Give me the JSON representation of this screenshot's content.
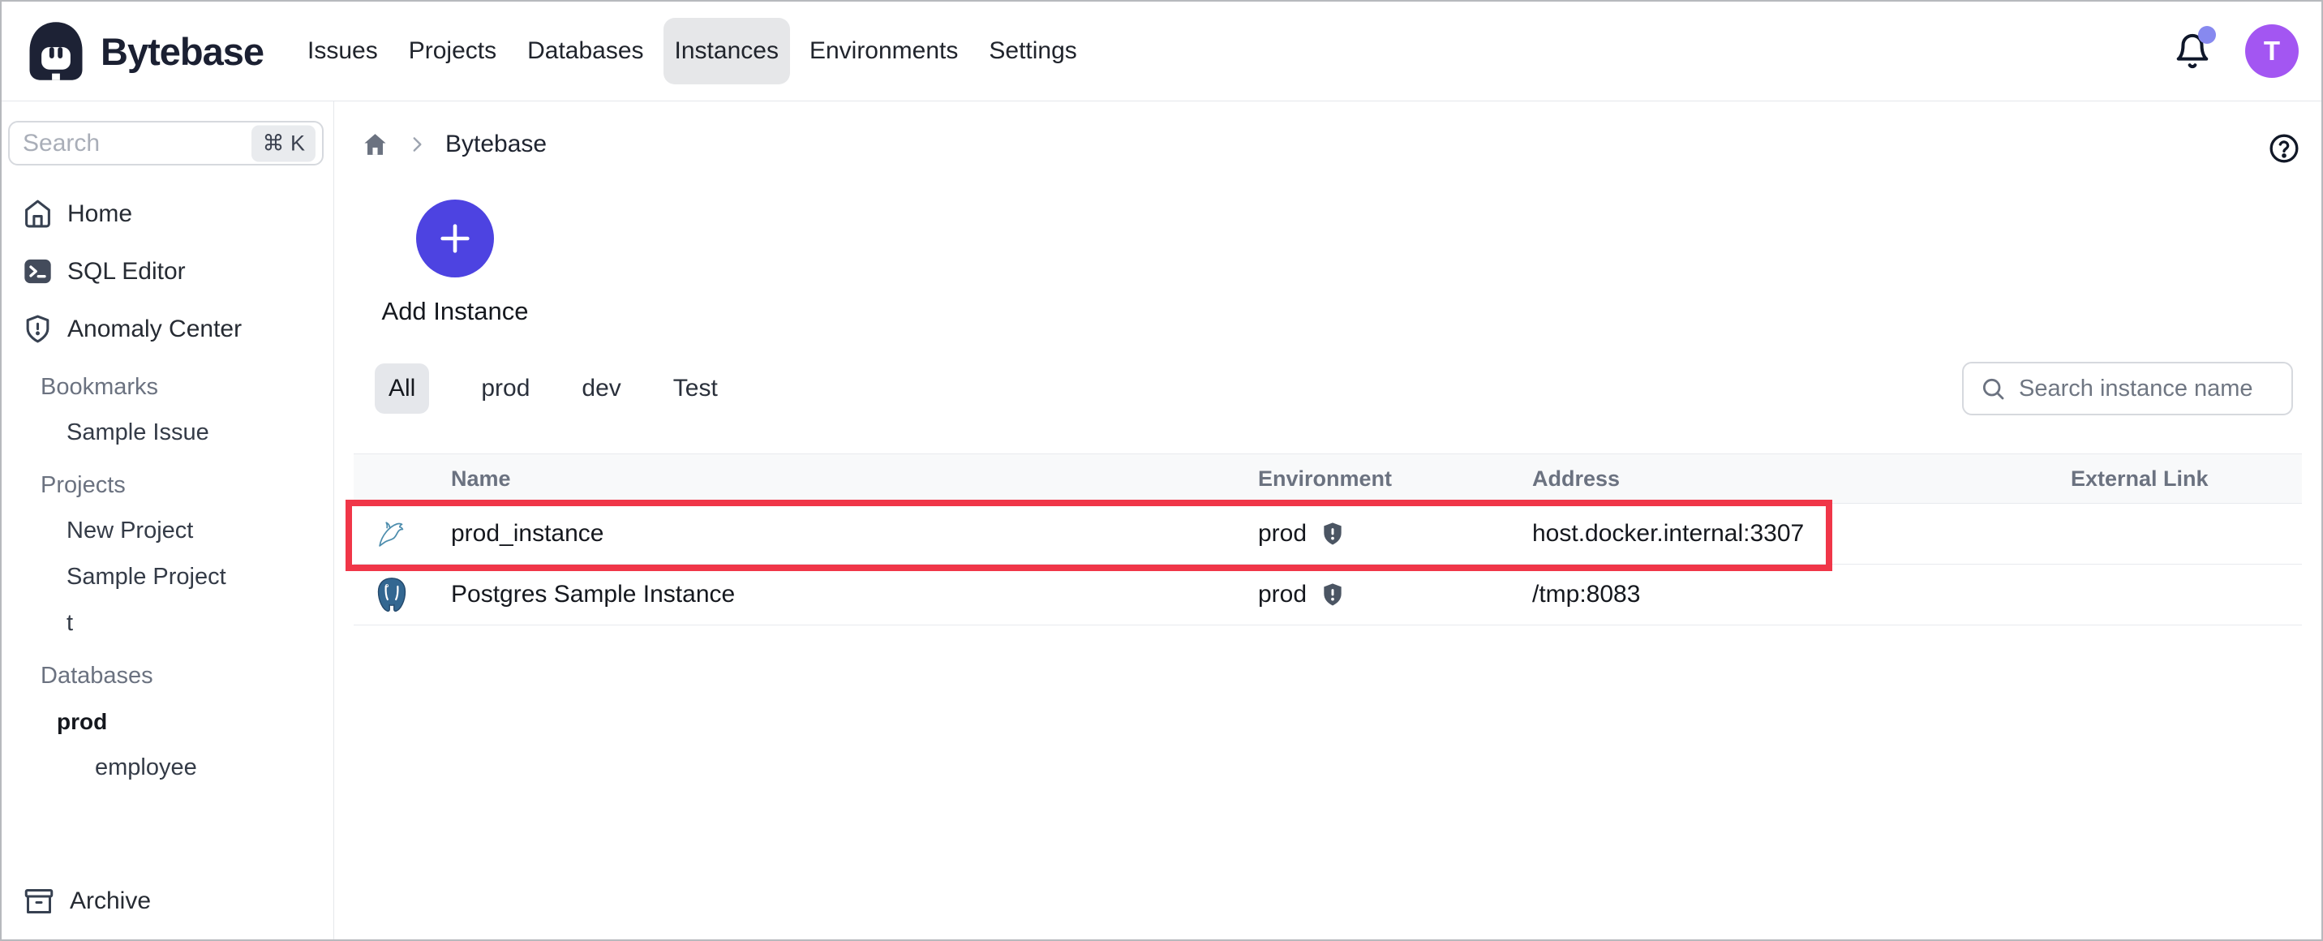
{
  "nav": {
    "brand": "Bytebase",
    "items": [
      "Issues",
      "Projects",
      "Databases",
      "Instances",
      "Environments",
      "Settings"
    ],
    "active_item": "Instances",
    "avatar_letter": "T"
  },
  "sidebar": {
    "search": {
      "placeholder": "Search",
      "shortcut": "⌘ K"
    },
    "primary_items": [
      "Home",
      "SQL Editor",
      "Anomaly Center"
    ],
    "sections": {
      "bookmarks": {
        "label": "Bookmarks",
        "items": [
          "Sample Issue"
        ]
      },
      "projects": {
        "label": "Projects",
        "items": [
          "New Project",
          "Sample Project",
          "t"
        ]
      },
      "databases": {
        "label": "Databases",
        "environment": "prod",
        "items": [
          "employee"
        ]
      }
    },
    "archive_label": "Archive"
  },
  "main": {
    "breadcrumb": {
      "current": "Bytebase"
    },
    "add_instance_label": "Add Instance",
    "tabs": [
      "All",
      "prod",
      "dev",
      "Test"
    ],
    "active_tab": "All",
    "search": {
      "placeholder": "Search instance name"
    },
    "table": {
      "columns": [
        "Name",
        "Environment",
        "Address",
        "External Link"
      ],
      "rows": [
        {
          "engine": "mysql",
          "name": "prod_instance",
          "environment": "prod",
          "address": "host.docker.internal:3307",
          "external_link": "",
          "highlighted": true
        },
        {
          "engine": "postgres",
          "name": "Postgres Sample Instance",
          "environment": "prod",
          "address": "/tmp:8083",
          "external_link": "",
          "highlighted": false
        }
      ]
    }
  },
  "colors": {
    "accent": "#4d43e1",
    "annotation_red": "#f03648",
    "avatar_purple": "#a356f2",
    "notification_dot": "#8789ef",
    "brand_navy": "#1d2235",
    "active_tab_bg": "#e5e7eb"
  }
}
